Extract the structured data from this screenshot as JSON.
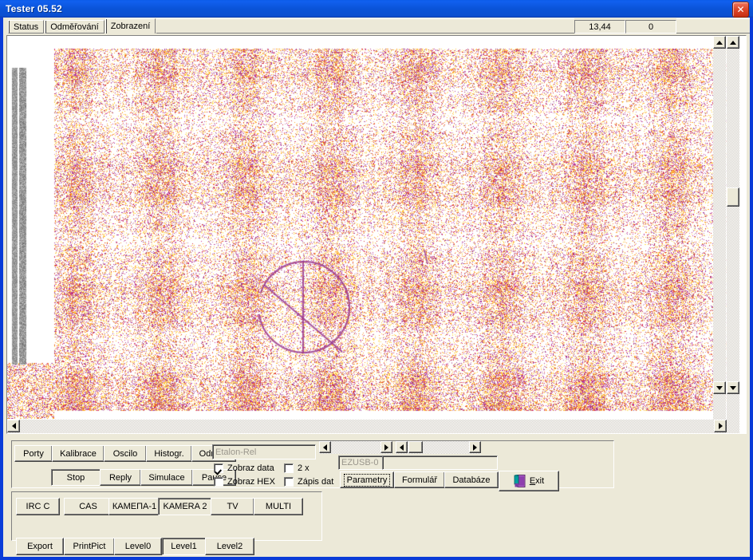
{
  "window": {
    "title": "Tester 05.52",
    "close_label": "✕",
    "close_icon": "close-icon"
  },
  "tabs": [
    {
      "label": "Status",
      "selected": false
    },
    {
      "label": "Odměřování",
      "selected": false
    },
    {
      "label": "Zobrazení",
      "selected": true
    }
  ],
  "readouts": [
    {
      "name": "value-1",
      "value": "13,44"
    },
    {
      "name": "value-2",
      "value": "0"
    }
  ],
  "image_panel": {
    "name": "camera-image-view",
    "scroll_v_outer": "vertical-scrollbar-outer",
    "scroll_v_inner": "vertical-scrollbar-inner",
    "scroll_h": "horizontal-scrollbar"
  },
  "controls": {
    "row_tools": [
      {
        "label": "Porty",
        "state": "up"
      },
      {
        "label": "Kalibrace",
        "state": "up"
      },
      {
        "label": "Oscilo",
        "state": "up"
      },
      {
        "label": "Histogr.",
        "state": "up"
      },
      {
        "label": "Odměř.",
        "state": "up"
      }
    ],
    "row_run": [
      {
        "label": "Stop",
        "state": "down"
      },
      {
        "label": "Reply",
        "state": "up"
      },
      {
        "label": "Simulace",
        "state": "up"
      },
      {
        "label": "Pause",
        "state": "up"
      }
    ],
    "etalon_field": {
      "value": "Etalon-Rel",
      "placeholder": "Etalon-Rel"
    },
    "checkboxes": [
      {
        "label": "Zobraz data",
        "checked": true
      },
      {
        "label": "2 x",
        "checked": false
      },
      {
        "label": "Zobraz HEX",
        "checked": false
      },
      {
        "label": "Zápis dat",
        "checked": false
      }
    ],
    "device_field": {
      "value": "EZUSB-0",
      "placeholder": "EZUSB-0"
    },
    "row_dialogs": [
      {
        "label": "Parametry",
        "state": "up",
        "focused": true
      },
      {
        "label": "Formulář",
        "state": "up",
        "focused": false
      },
      {
        "label": "Databáze",
        "state": "up",
        "focused": false
      }
    ],
    "exit_button": {
      "label": "Exit",
      "icon": "exit-door-icon",
      "accesskey": "E"
    },
    "row_sources": [
      {
        "label": "IRC C",
        "state": "up"
      },
      {
        "label": "CAS",
        "state": "up"
      },
      {
        "label": "КАМЕПА-1",
        "state": "up"
      },
      {
        "label": "KAMERA 2",
        "state": "down"
      },
      {
        "label": "TV",
        "state": "up"
      },
      {
        "label": "MULTI",
        "state": "up"
      }
    ],
    "row_levels": [
      {
        "label": "Export",
        "state": "up"
      },
      {
        "label": "PrintPict",
        "state": "up"
      },
      {
        "label": "Level0",
        "state": "up"
      },
      {
        "label": "Level1",
        "state": "down"
      },
      {
        "label": "Level2",
        "state": "up"
      }
    ]
  },
  "colors": {
    "titlebar_blue": "#0a53d8",
    "window_border": "#0a3cd8",
    "face": "#ece9d8",
    "noise_yellow": "#ffcc33",
    "noise_orange": "#ff9933",
    "noise_magenta": "#cc3399",
    "noise_purple": "#993399",
    "noise_red": "#dd3333"
  }
}
